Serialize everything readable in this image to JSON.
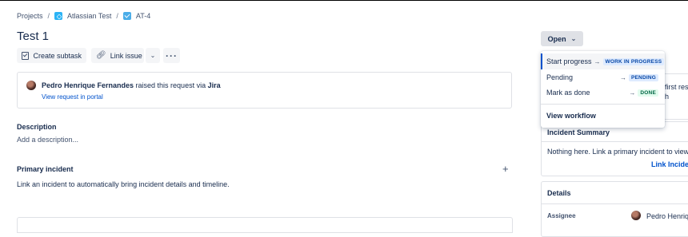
{
  "breadcrumb": {
    "projects": "Projects",
    "separator": "/",
    "project_name": "Atlassian Test",
    "issue_key": "AT-4"
  },
  "issue": {
    "title": "Test 1"
  },
  "actions": {
    "create_subtask": "Create subtask",
    "link_issue": "Link issue"
  },
  "request": {
    "requester": "Pedro Henrique Fernandes",
    "raised_text": " raised this request via ",
    "channel": "Jira",
    "portal_link": "View request in portal"
  },
  "description": {
    "heading": "Description",
    "placeholder": "Add a description..."
  },
  "primary_incident": {
    "heading": "Primary incident",
    "text": "Link an incident to automatically bring incident details and timeline."
  },
  "status": {
    "label": "Open"
  },
  "status_menu": {
    "items": [
      {
        "label": "Start progress",
        "target": "WORK IN PROGRESS"
      },
      {
        "label": "Pending",
        "target": "PENDING"
      },
      {
        "label": "Mark as done",
        "target": "DONE"
      }
    ],
    "view_workflow": "View workflow"
  },
  "right_panel": {
    "partial_line1": "first res",
    "partial_line2": "h"
  },
  "incident_summary": {
    "heading": "Incident Summary",
    "text": "Nothing here. Link a primary incident to view",
    "link": "Link Inciden"
  },
  "details": {
    "heading": "Details",
    "assignee_label": "Assignee",
    "assignee_name": "Pedro Henriqu"
  },
  "colors": {
    "link": "#0052cc",
    "text": "#172b4d",
    "lozenge_blue_bg": "#deebff",
    "lozenge_green_bg": "#e3fcef"
  }
}
